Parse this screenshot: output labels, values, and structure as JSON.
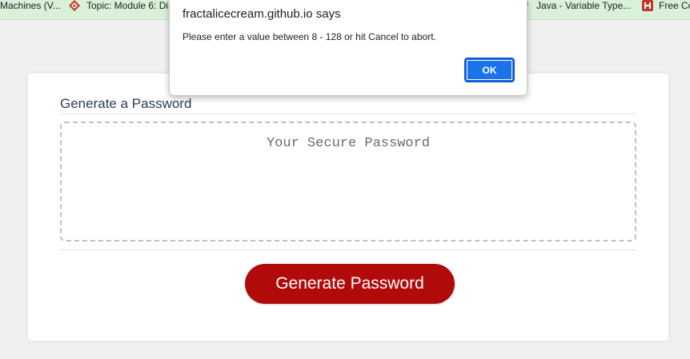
{
  "bookmarks": [
    {
      "label": "Machines (V...",
      "icon": "none"
    },
    {
      "label": "Topic: Module 6: Di...",
      "icon": "canvas-logo-icon"
    },
    {
      "label": "Java - Variable Type...",
      "icon": "green-circle-icon"
    },
    {
      "label": "Free Co",
      "icon": "freecodecamp-icon"
    }
  ],
  "dialog": {
    "origin": "fractalicecream.github.io says",
    "message": "Please enter a value between 8 - 128 or hit Cancel to abort.",
    "ok_label": "OK"
  },
  "card": {
    "title": "Generate a Password",
    "password_placeholder": "Your Secure Password",
    "password_value": "",
    "generate_label": "Generate Password"
  },
  "colors": {
    "bookmark_bar_bg": "#d9f0d9",
    "button_red": "#b10a0a",
    "dialog_ok_blue": "#1a73e8",
    "page_bg": "#f0f0f0"
  }
}
